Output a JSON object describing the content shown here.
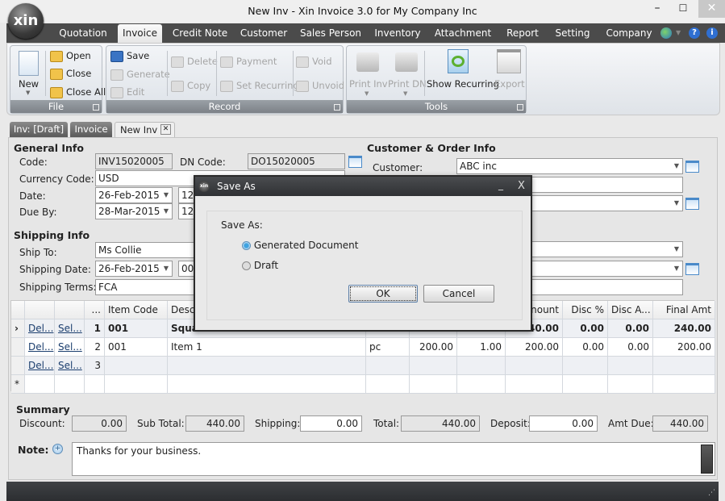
{
  "window": {
    "title": "New Inv - Xin Invoice 3.0 for My Company Inc",
    "logo": "xin",
    "minimize": "–",
    "maximize": "☐",
    "close": "✕"
  },
  "menu": {
    "tabs": [
      "Quotation",
      "Invoice",
      "Credit Note",
      "Customer",
      "Sales Person",
      "Inventory",
      "Attachment",
      "Report",
      "Setting",
      "Company"
    ],
    "active": "Invoice",
    "icons": [
      "globe-icon",
      "help-icon",
      "info-icon"
    ]
  },
  "ribbon": {
    "file": {
      "label": "File",
      "new": "New",
      "open": "Open",
      "close": "Close",
      "close_all": "Close All"
    },
    "record": {
      "label": "Record",
      "save": "Save",
      "generate": "Generate",
      "edit": "Edit",
      "delete": "Delete",
      "copy": "Copy",
      "payment": "Payment",
      "set_recurring": "Set Recurring",
      "void": "Void",
      "unvoid": "Unvoid"
    },
    "tools": {
      "label": "Tools",
      "print_inv": "Print Inv",
      "print_dn": "Print DN",
      "show_recurring": "Show Recurring",
      "export": "Export"
    }
  },
  "doc_tabs": [
    {
      "label": "Inv: [Draft]"
    },
    {
      "label": "Invoice"
    },
    {
      "label": "New Inv",
      "active": true,
      "close": "✕"
    }
  ],
  "general_info": {
    "title": "General Info",
    "code_label": "Code:",
    "code": "INV15020005",
    "dn_code_label": "DN Code:",
    "dn_code": "DO15020005",
    "currency_label": "Currency Code:",
    "currency": "USD",
    "date_label": "Date:",
    "date": "26-Feb-2015",
    "date_time": "12",
    "due_label": "Due By:",
    "due": "28-Mar-2015",
    "due_time": "12"
  },
  "shipping_info": {
    "title": "Shipping Info",
    "ship_to_label": "Ship To:",
    "ship_to": "Ms Collie",
    "ship_date_label": "Shipping Date:",
    "ship_date": "26-Feb-2015",
    "ship_time": "00",
    "terms_label": "Shipping Terms:",
    "terms": "FCA"
  },
  "customer_info": {
    "title": "Customer & Order Info",
    "customer_label": "Customer:",
    "customer": "ABC inc"
  },
  "grid": {
    "columns": [
      "",
      "",
      "",
      "...",
      "Item Code",
      "Desc",
      "",
      "",
      "",
      "nount",
      "Disc %",
      "Disc A...",
      "Final Amt"
    ],
    "rows": [
      {
        "marker": "›",
        "del": "Del...",
        "sel": "Sel...",
        "no": "1",
        "code": "001",
        "desc": "Squa",
        "uom": "",
        "price": "",
        "qty": "",
        "amount": "40.00",
        "disc_pct": "0.00",
        "disc_amt": "0.00",
        "final": "240.00",
        "bold": true
      },
      {
        "marker": "",
        "del": "Del...",
        "sel": "Sel...",
        "no": "2",
        "code": "001",
        "desc": "Item 1",
        "uom": "pc",
        "price": "200.00",
        "qty": "1.00",
        "amount": "200.00",
        "disc_pct": "0.00",
        "disc_amt": "0.00",
        "final": "200.00"
      },
      {
        "marker": "",
        "del": "Del...",
        "sel": "Sel...",
        "no": "3",
        "code": "",
        "desc": "",
        "uom": "",
        "price": "",
        "qty": "",
        "amount": "",
        "disc_pct": "",
        "disc_amt": "",
        "final": ""
      },
      {
        "marker": "*",
        "del": "",
        "sel": "",
        "no": "",
        "code": "",
        "desc": "",
        "uom": "",
        "price": "",
        "qty": "",
        "amount": "",
        "disc_pct": "",
        "disc_amt": "",
        "final": ""
      }
    ]
  },
  "summary": {
    "title": "Summary",
    "discount_label": "Discount:",
    "discount": "0.00",
    "subtotal_label": "Sub Total:",
    "subtotal": "440.00",
    "shipping_label": "Shipping:",
    "shipping": "0.00",
    "total_label": "Total:",
    "total": "440.00",
    "deposit_label": "Deposit:",
    "deposit": "0.00",
    "amt_due_label": "Amt Due:",
    "amt_due": "440.00"
  },
  "note": {
    "label": "Note:",
    "text": "Thanks for your business."
  },
  "dialog": {
    "title": "Save As",
    "prompt": "Save As:",
    "options": [
      {
        "label": "Generated Document",
        "selected": true
      },
      {
        "label": "Draft",
        "selected": false
      }
    ],
    "ok": "OK",
    "cancel": "Cancel",
    "minimize": "_",
    "close": "X"
  }
}
